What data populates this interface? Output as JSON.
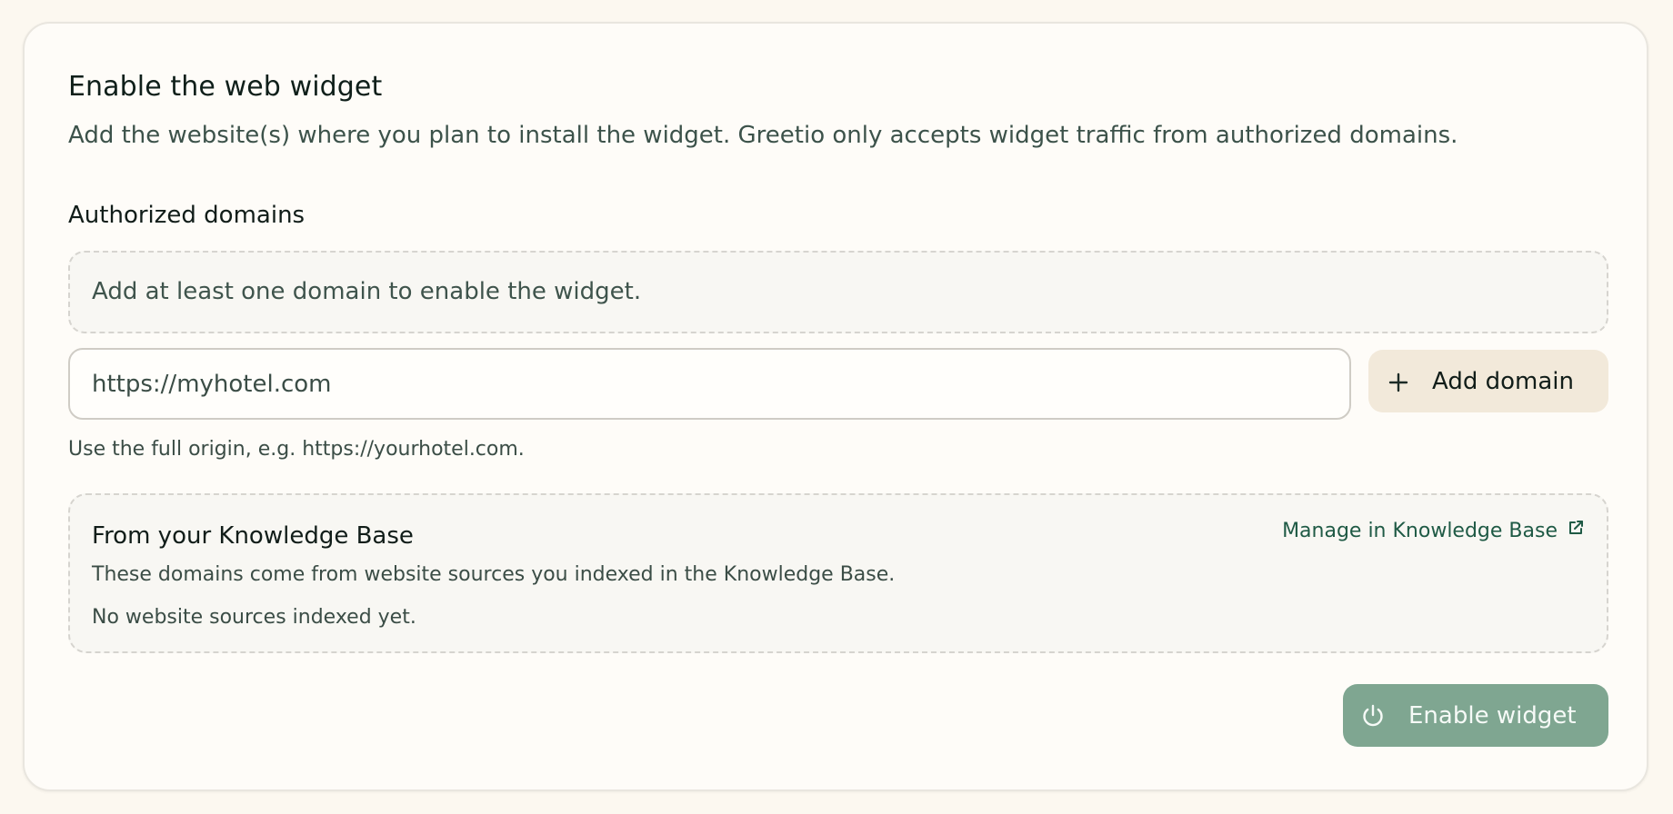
{
  "header": {
    "title": "Enable the web widget",
    "subtitle": "Add the website(s) where you plan to install the widget. Greetio only accepts widget traffic from authorized domains."
  },
  "domains": {
    "label": "Authorized domains",
    "empty_message": "Add at least one domain to enable the widget.",
    "input_placeholder": "https://myhotel.com",
    "add_button_label": "Add domain",
    "hint": "Use the full origin, e.g. https://yourhotel.com."
  },
  "knowledge_base": {
    "title": "From your Knowledge Base",
    "link_label": "Manage in Knowledge Base",
    "description": "These domains come from website sources you indexed in the Knowledge Base.",
    "empty_message": "No website sources indexed yet."
  },
  "actions": {
    "enable_label": "Enable widget"
  },
  "icons": {
    "add": "plus-icon",
    "external": "external-link-icon",
    "enable": "power-icon"
  },
  "colors": {
    "page_background": "#fcf8f0",
    "card_background": "#fefcf8",
    "accent_link": "#1f5a45",
    "add_button_bg": "#f2e9da",
    "enable_button_bg": "#7fa691"
  }
}
